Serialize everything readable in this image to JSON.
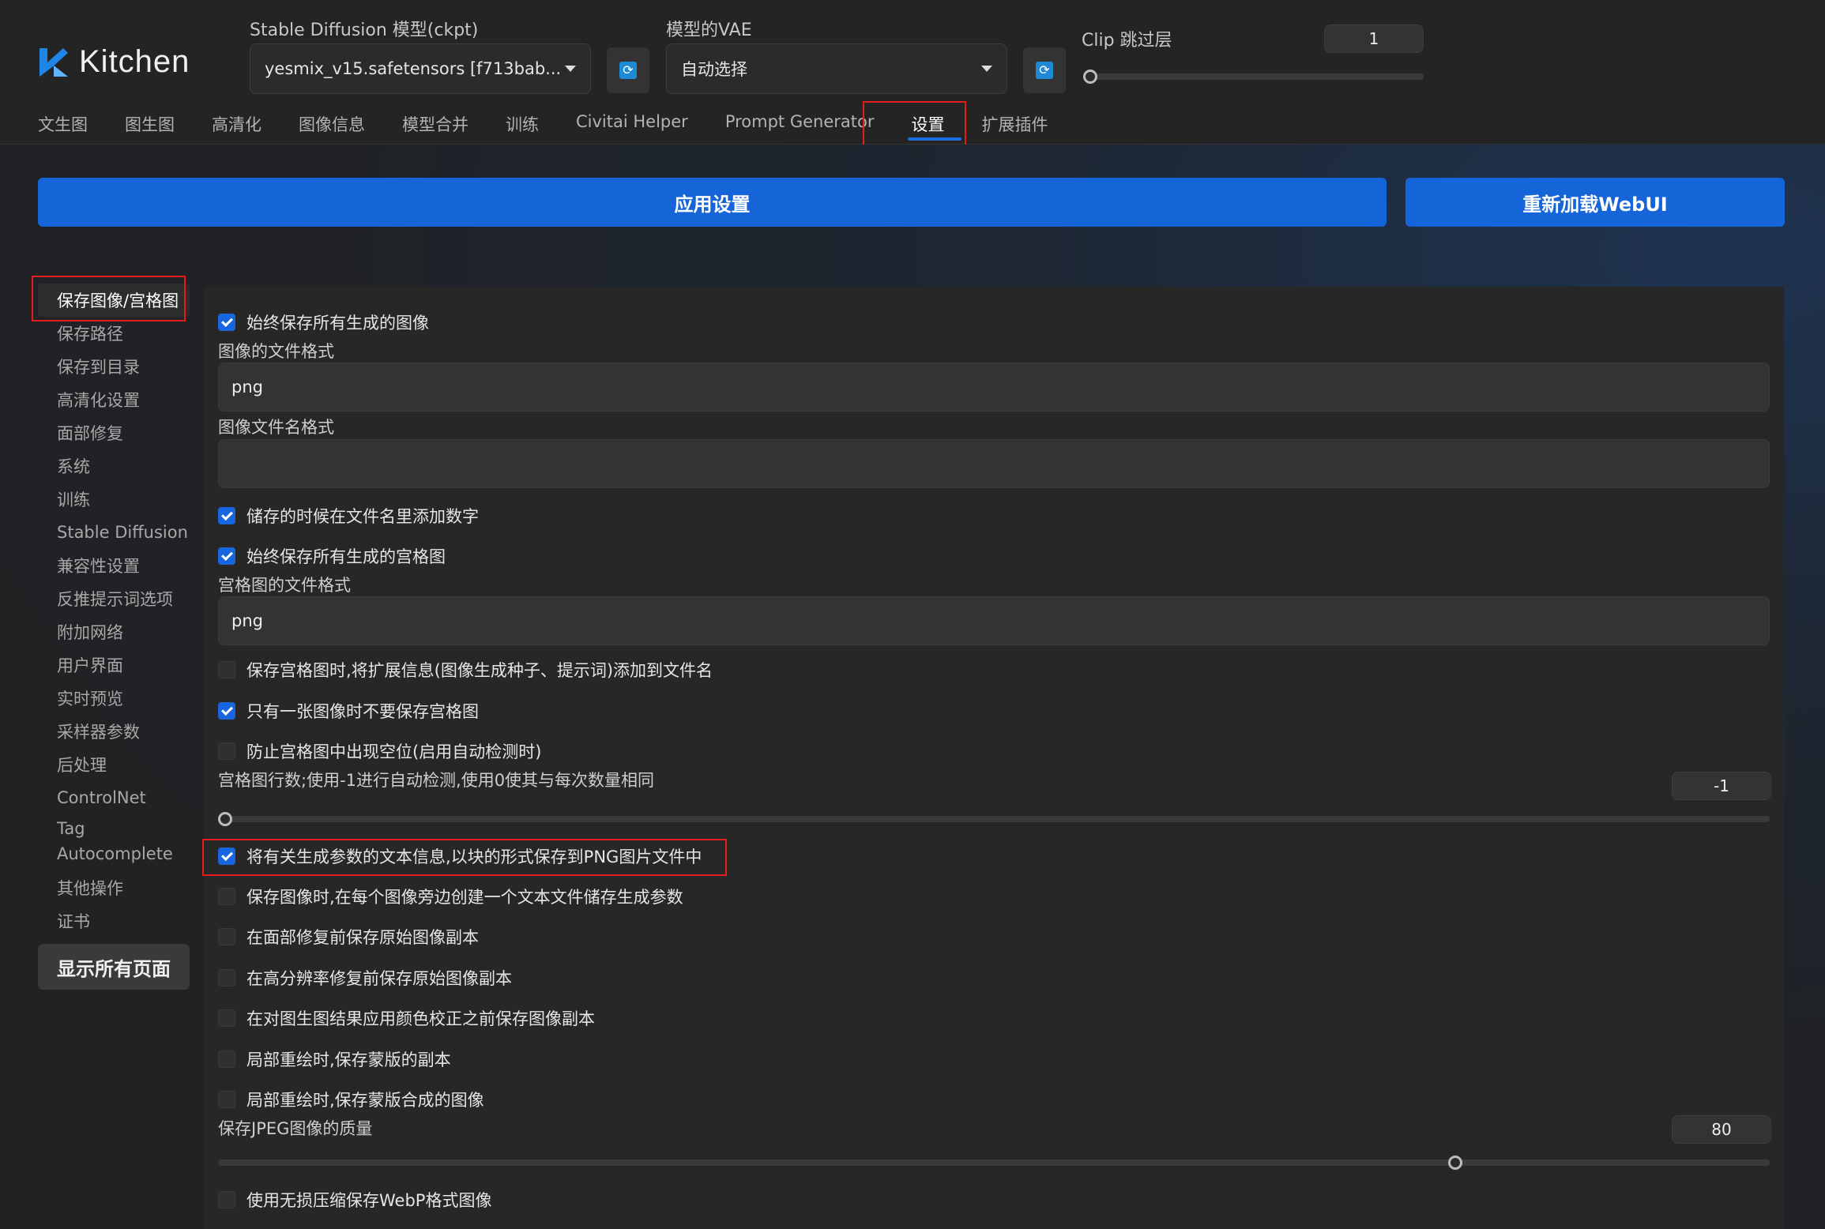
{
  "app": {
    "logo_text": "Kitchen",
    "accent": "#1565d8",
    "highlight": "#e31d1d"
  },
  "header": {
    "ckpt_label": "Stable Diffusion 模型(ckpt)",
    "ckpt_value": "yesmix_v15.safetensors [f713bab...",
    "vae_label": "模型的VAE",
    "vae_value": "自动选择",
    "clip_label": "Clip 跳过层",
    "clip_value": "1",
    "refresh_icon": "refresh-icon"
  },
  "tabs": [
    "文生图",
    "图生图",
    "高清化",
    "图像信息",
    "模型合并",
    "训练",
    "Civitai Helper",
    "Prompt Generator",
    "设置",
    "扩展插件"
  ],
  "active_tab": "设置",
  "actions": {
    "apply": "应用设置",
    "reload": "重新加载WebUI"
  },
  "sidebar": {
    "items": [
      "保存图像/宫格图",
      "保存路径",
      "保存到目录",
      "高清化设置",
      "面部修复",
      "系统",
      "训练",
      "Stable Diffusion",
      "兼容性设置",
      "反推提示词选项",
      "附加网络",
      "用户界面",
      "实时预览",
      "采样器参数",
      "后处理",
      "ControlNet",
      "Tag Autocomplete",
      "其他操作",
      "证书"
    ],
    "show_all": "显示所有页面"
  },
  "settings": {
    "save_all_images": {
      "label": "始终保存所有生成的图像",
      "checked": true
    },
    "image_format_label": "图像的文件格式",
    "image_format_value": "png",
    "filename_pattern_label": "图像文件名格式",
    "filename_pattern_value": "",
    "add_number": {
      "label": "储存的时候在文件名里添加数字",
      "checked": true
    },
    "save_all_grids": {
      "label": "始终保存所有生成的宫格图",
      "checked": true
    },
    "grid_format_label": "宫格图的文件格式",
    "grid_format_value": "png",
    "grid_extended_filename": {
      "label": "保存宫格图时,将扩展信息(图像生成种子、提示词)添加到文件名",
      "checked": false
    },
    "grid_only_if_multiple": {
      "label": "只有一张图像时不要保存宫格图",
      "checked": true
    },
    "grid_prevent_empty": {
      "label": "防止宫格图中出现空位(启用自动检测时)",
      "checked": false
    },
    "grid_rows_label": "宫格图行数;使用-1进行自动检测,使用0使其与每次数量相同",
    "grid_rows_value": "-1",
    "grid_rows_fraction": 0,
    "pnginfo": {
      "label": "将有关生成参数的文本信息,以块的形式保存到PNG图片文件中",
      "checked": true
    },
    "save_txt": {
      "label": "保存图像时,在每个图像旁边创建一个文本文件储存生成参数",
      "checked": false
    },
    "before_face_restore": {
      "label": "在面部修复前保存原始图像副本",
      "checked": false
    },
    "before_highres_fix": {
      "label": "在高分辨率修复前保存原始图像副本",
      "checked": false
    },
    "before_color_correction": {
      "label": "在对图生图结果应用颜色校正之前保存图像副本",
      "checked": false
    },
    "inpaint_mask": {
      "label": "局部重绘时,保存蒙版的副本",
      "checked": false
    },
    "inpaint_composite": {
      "label": "局部重绘时,保存蒙版合成的图像",
      "checked": false
    },
    "jpeg_quality_label": "保存JPEG图像的质量",
    "jpeg_quality_value": "80",
    "jpeg_quality_fraction": 0.8,
    "webp_lossless": {
      "label": "使用无损压缩保存WebP格式图像",
      "checked": false
    }
  }
}
